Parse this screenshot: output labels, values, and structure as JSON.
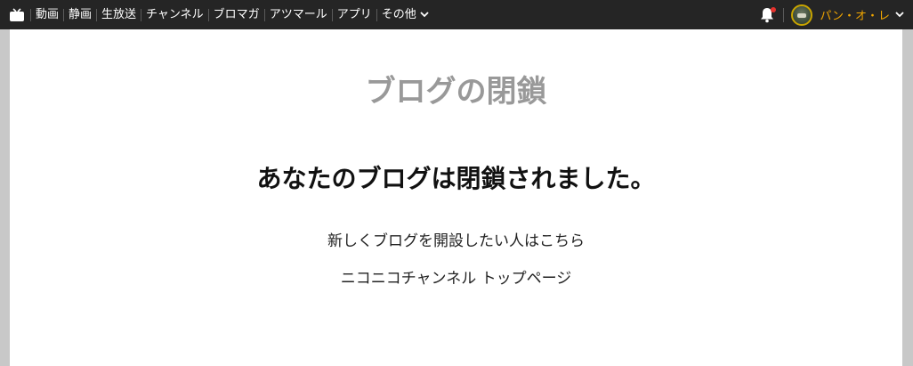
{
  "nav": {
    "items": [
      "動画",
      "静画",
      "生放送",
      "チャンネル",
      "ブロマガ",
      "アツマール",
      "アプリ"
    ],
    "more_label": "その他"
  },
  "user": {
    "name": "パン・オ・レ"
  },
  "main": {
    "title": "ブログの閉鎖",
    "message": "あなたのブログは閉鎖されました。",
    "new_blog_link": "新しくブログを開設したい人はこちら",
    "channel_top_link": "ニコニコチャンネル トップページ"
  },
  "colors": {
    "topbar_bg": "#252525",
    "username": "#f0a500",
    "notification_dot": "#e5322d",
    "title_gray": "#999999"
  },
  "icons": [
    "tv-logo-icon",
    "chevron-down-icon",
    "bell-icon",
    "avatar"
  ]
}
